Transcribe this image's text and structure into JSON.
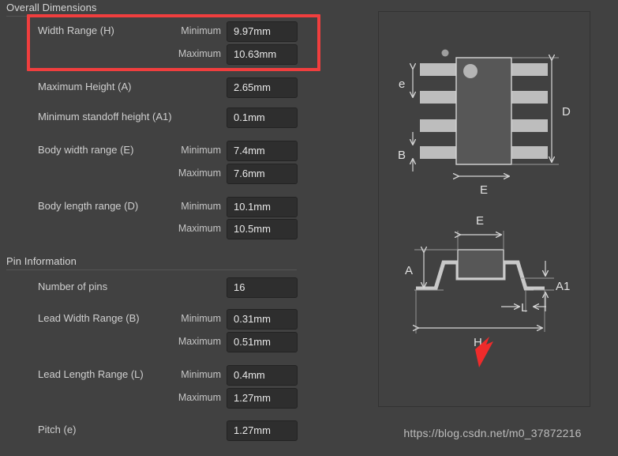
{
  "sections": [
    {
      "id": "overall-dimensions",
      "title": "Overall Dimensions",
      "rows": [
        {
          "label": "Width Range (H)",
          "qualifier": "Minimum",
          "value": "9.97mm"
        },
        {
          "label": "",
          "qualifier": "Maximum",
          "value": "10.63mm"
        },
        {
          "label": "Maximum Height (A)",
          "qualifier": "",
          "value": "2.65mm"
        },
        {
          "label": "Minimum standoff height (A1)",
          "qualifier": "",
          "value": "0.1mm"
        },
        {
          "label": "Body width range (E)",
          "qualifier": "Minimum",
          "value": "7.4mm"
        },
        {
          "label": "",
          "qualifier": "Maximum",
          "value": "7.6mm"
        },
        {
          "label": "Body length range (D)",
          "qualifier": "Minimum",
          "value": "10.1mm"
        },
        {
          "label": "",
          "qualifier": "Maximum",
          "value": "10.5mm"
        }
      ]
    },
    {
      "id": "pin-information",
      "title": "Pin Information",
      "rows": [
        {
          "label": "Number of pins",
          "qualifier": "",
          "value": "16"
        },
        {
          "label": "Lead Width Range (B)",
          "qualifier": "Minimum",
          "value": "0.31mm"
        },
        {
          "label": "",
          "qualifier": "Maximum",
          "value": "0.51mm"
        },
        {
          "label": "Lead Length Range (L)",
          "qualifier": "Minimum",
          "value": "0.4mm"
        },
        {
          "label": "",
          "qualifier": "Maximum",
          "value": "1.27mm"
        },
        {
          "label": "Pitch (e)",
          "qualifier": "",
          "value": "1.27mm"
        }
      ]
    }
  ],
  "highlight": {
    "name": "width-range-highlight",
    "color": "#f03e3e"
  },
  "diagram": {
    "top_view": {
      "name": "package-top-view",
      "labels": {
        "pitch": "e",
        "lead_width": "B",
        "body_length": "D",
        "body_width": "E"
      },
      "pins_per_side": 4,
      "has_pin1_dot": true
    },
    "side_view": {
      "name": "package-side-view",
      "labels": {
        "height": "A",
        "standoff": "A1",
        "lead_length": "L",
        "overall_width": "H",
        "body_width": "E"
      },
      "arrow_points_to": "H"
    }
  },
  "watermark": {
    "text": "https://blog.csdn.net/m0_37872216"
  },
  "colors": {
    "background": "#414141",
    "field_background": "#2e2e2e",
    "text": "#cfcfcf",
    "accent_red": "#f03e3e",
    "diagram_line": "#c8c8c8"
  }
}
